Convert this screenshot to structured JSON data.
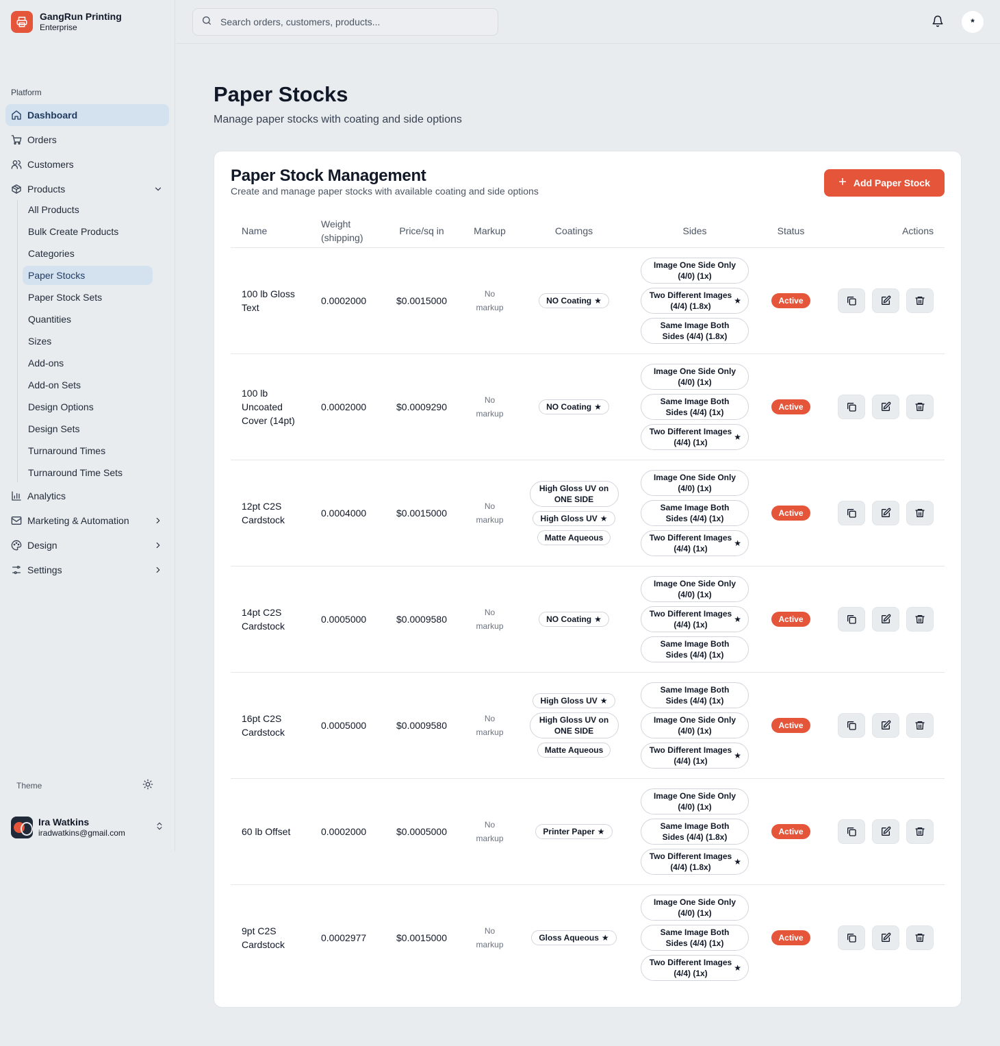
{
  "brand": {
    "name": "GangRun Printing",
    "plan": "Enterprise"
  },
  "sidebar": {
    "section_label": "Platform",
    "items": [
      {
        "label": "Dashboard",
        "icon": "home-icon",
        "active": true
      },
      {
        "label": "Orders",
        "icon": "cart-icon"
      },
      {
        "label": "Customers",
        "icon": "users-icon"
      },
      {
        "label": "Products",
        "icon": "package-icon",
        "expanded": true
      }
    ],
    "products_sub": [
      "All Products",
      "Bulk Create Products",
      "Categories",
      "Paper Stocks",
      "Paper Stock Sets",
      "Quantities",
      "Sizes",
      "Add-ons",
      "Add-on Sets",
      "Design Options",
      "Design Sets",
      "Turnaround Times",
      "Turnaround Time Sets"
    ],
    "products_sub_active": "Paper Stocks",
    "items_after": [
      {
        "label": "Analytics",
        "icon": "bar-chart-icon"
      },
      {
        "label": "Marketing & Automation",
        "icon": "mail-icon"
      },
      {
        "label": "Design",
        "icon": "palette-icon"
      },
      {
        "label": "Settings",
        "icon": "sliders-icon"
      }
    ],
    "theme_label": "Theme",
    "user": {
      "name": "Ira Watkins",
      "email": "iradwatkins@gmail.com"
    }
  },
  "topbar": {
    "search_placeholder": "Search orders, customers, products...",
    "avatar_text": "*"
  },
  "page": {
    "title": "Paper Stocks",
    "subtitle": "Manage paper stocks with coating and side options"
  },
  "card": {
    "title": "Paper Stock Management",
    "subtitle": "Create and manage paper stocks with available coating and side options",
    "add_button": "Add Paper Stock"
  },
  "table": {
    "headers": {
      "name": "Name",
      "weight": "Weight (shipping)",
      "price": "Price/sq in",
      "markup": "Markup",
      "coatings": "Coatings",
      "sides": "Sides",
      "status": "Status",
      "actions": "Actions"
    },
    "rows": [
      {
        "name": "100 lb Gloss Text",
        "weight": "0.0002000",
        "price": "$0.0015000",
        "markup": "No markup",
        "coatings": [
          {
            "label": "NO Coating",
            "default": true
          }
        ],
        "sides": [
          {
            "label": "Image One Side Only (4/0) (1x)",
            "default": false
          },
          {
            "label": "Two Different Images (4/4) (1.8x)",
            "default": true
          },
          {
            "label": "Same Image Both Sides (4/4) (1.8x)",
            "default": false
          }
        ],
        "status": "Active"
      },
      {
        "name": "100 lb Uncoated Cover (14pt)",
        "weight": "0.0002000",
        "price": "$0.0009290",
        "markup": "No markup",
        "coatings": [
          {
            "label": "NO Coating",
            "default": true
          }
        ],
        "sides": [
          {
            "label": "Image One Side Only (4/0) (1x)",
            "default": false
          },
          {
            "label": "Same Image Both Sides (4/4) (1x)",
            "default": false
          },
          {
            "label": "Two Different Images (4/4) (1x)",
            "default": true
          }
        ],
        "status": "Active"
      },
      {
        "name": "12pt C2S Cardstock",
        "weight": "0.0004000",
        "price": "$0.0015000",
        "markup": "No markup",
        "coatings": [
          {
            "label": "High Gloss UV on ONE SIDE",
            "default": false,
            "wide": true
          },
          {
            "label": "High Gloss UV",
            "default": true
          },
          {
            "label": "Matte Aqueous",
            "default": false
          }
        ],
        "sides": [
          {
            "label": "Image One Side Only (4/0) (1x)",
            "default": false
          },
          {
            "label": "Same Image Both Sides (4/4) (1x)",
            "default": false
          },
          {
            "label": "Two Different Images (4/4) (1x)",
            "default": true
          }
        ],
        "status": "Active"
      },
      {
        "name": "14pt C2S Cardstock",
        "weight": "0.0005000",
        "price": "$0.0009580",
        "markup": "No markup",
        "coatings": [
          {
            "label": "NO Coating",
            "default": true
          }
        ],
        "sides": [
          {
            "label": "Image One Side Only (4/0) (1x)",
            "default": false
          },
          {
            "label": "Two Different Images (4/4) (1x)",
            "default": true
          },
          {
            "label": "Same Image Both Sides (4/4) (1x)",
            "default": false
          }
        ],
        "status": "Active"
      },
      {
        "name": "16pt C2S Cardstock",
        "weight": "0.0005000",
        "price": "$0.0009580",
        "markup": "No markup",
        "coatings": [
          {
            "label": "High Gloss UV",
            "default": true
          },
          {
            "label": "High Gloss UV on ONE SIDE",
            "default": false,
            "wide": true
          },
          {
            "label": "Matte Aqueous",
            "default": false
          }
        ],
        "sides": [
          {
            "label": "Same Image Both Sides (4/4) (1x)",
            "default": false
          },
          {
            "label": "Image One Side Only (4/0) (1x)",
            "default": false
          },
          {
            "label": "Two Different Images (4/4) (1x)",
            "default": true
          }
        ],
        "status": "Active"
      },
      {
        "name": "60 lb Offset",
        "weight": "0.0002000",
        "price": "$0.0005000",
        "markup": "No markup",
        "coatings": [
          {
            "label": "Printer Paper",
            "default": true
          }
        ],
        "sides": [
          {
            "label": "Image One Side Only (4/0) (1x)",
            "default": false
          },
          {
            "label": "Same Image Both Sides (4/4) (1.8x)",
            "default": false
          },
          {
            "label": "Two Different Images (4/4) (1.8x)",
            "default": true
          }
        ],
        "status": "Active"
      },
      {
        "name": "9pt C2S Cardstock",
        "weight": "0.0002977",
        "price": "$0.0015000",
        "markup": "No markup",
        "coatings": [
          {
            "label": "Gloss Aqueous",
            "default": true
          }
        ],
        "sides": [
          {
            "label": "Image One Side Only (4/0) (1x)",
            "default": false
          },
          {
            "label": "Same Image Both Sides (4/4) (1x)",
            "default": false
          },
          {
            "label": "Two Different Images (4/4) (1x)",
            "default": true
          }
        ],
        "status": "Active"
      }
    ]
  },
  "colors": {
    "accent": "#e5553a",
    "active_nav": "#d4e2f0",
    "background": "#e9ecef"
  }
}
